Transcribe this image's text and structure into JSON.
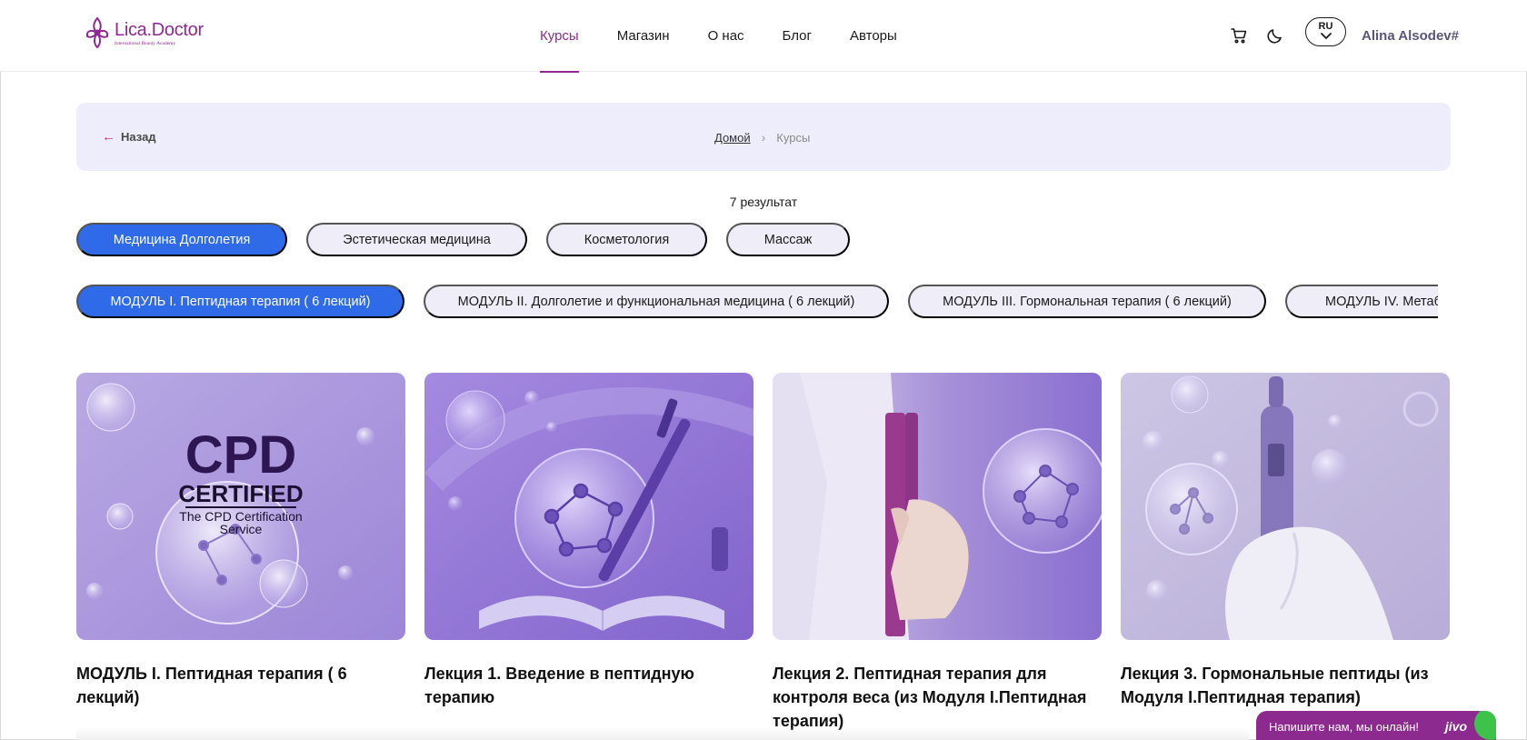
{
  "header": {
    "logo_name": "Lica.Doctor",
    "logo_sub": "International Beauty Academy",
    "nav": [
      "Курсы",
      "Магазин",
      "О нас",
      "Блог",
      "Авторы"
    ],
    "active_nav": "Курсы",
    "language": "RU",
    "user_name": "Alina Alsodev#",
    "icons": [
      "cart-icon",
      "moon-icon",
      "chevron-down-icon"
    ]
  },
  "breadcrumb": {
    "back_label": "Назад",
    "home": "Домой",
    "current": "Курсы"
  },
  "results_label": "7 результат",
  "categories": [
    "Медицина Долголетия",
    "Эстетическая медицина",
    "Косметология",
    "Массаж"
  ],
  "active_category": "Медицина Долголетия",
  "modules": [
    "МОДУЛЬ I. Пептидная терапия ( 6 лекций)",
    "МОДУЛЬ II. Долголетие и функциональная медицина ( 6 лекций)",
    "МОДУЛЬ III. Гормональная терапия ( 6 лекций)",
    "МОДУЛЬ IV. Метаболическая"
  ],
  "active_module": "МОДУЛЬ I. Пептидная терапия ( 6 лекций)",
  "cards": [
    {
      "title": "МОДУЛЬ I. Пептидная терапия ( 6 лекций)",
      "image": "cpd-certified-badge",
      "badge_main": "CPD",
      "badge_sub": "CERTIFIED",
      "badge_caption_1": "The CPD Certification",
      "badge_caption_2": "Service"
    },
    {
      "title": "Лекция 1. Введение в пептидную терапию",
      "image": "molecule-bubbles-book-pen"
    },
    {
      "title": "Лекция 2. Пептидная терапия для контроля веса (из Модуля I.Пептидная терапия)",
      "image": "measuring-tape-hand"
    },
    {
      "title": "Лекция 3. Гормональные пептиды (из Модуля I.Пептидная терапия)",
      "image": "injection-pen-glove"
    }
  ],
  "chat": {
    "label": "Напишите нам, мы онлайн!",
    "brand": "jivo"
  },
  "colors": {
    "brand": "#8d2a8f",
    "accent_blue": "#2f6ae8",
    "pill_bg": "#efeef8",
    "crumb_bg": "#eeedfb"
  }
}
